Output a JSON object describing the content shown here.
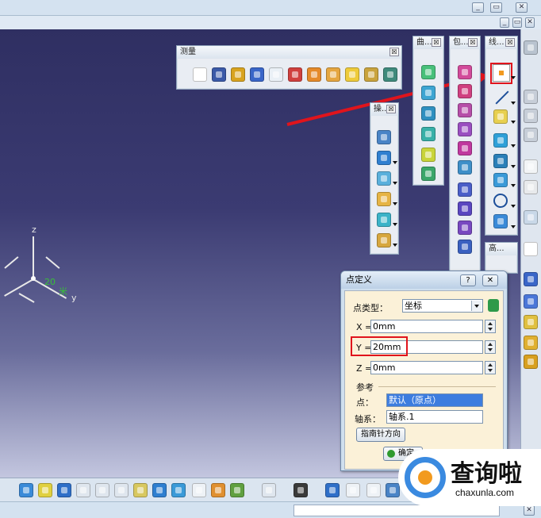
{
  "window": {
    "restore_glyph": "▭",
    "close_glyph": "✕",
    "minimize_glyph": "_"
  },
  "toolbars": {
    "measure": {
      "title": "测量",
      "close_glyph": "☒"
    },
    "curves": {
      "title": "曲...",
      "close_glyph": "☒"
    },
    "surfaces": {
      "title": "包...",
      "close_glyph": "☒"
    },
    "wireframe": {
      "title": "线...",
      "close_glyph": "☒"
    },
    "operations": {
      "title": "操...",
      "close_glyph": "☒"
    },
    "advanced": {
      "title": "高..."
    }
  },
  "compass": {
    "z": "z",
    "y": "y",
    "value": "20",
    "mark": "米"
  },
  "dialog": {
    "title": "点定义",
    "help_glyph": "?",
    "close_glyph": "✕",
    "point_type_label": "点类型：",
    "point_type_value": "坐标",
    "x_label": "X =",
    "x_value": "0mm",
    "y_label": "Y =",
    "y_value": "20mm",
    "z_label": "Z =",
    "z_value": "0mm",
    "reference_label": "参考",
    "point_label": "点：",
    "point_value": "默认（原点）",
    "axis_label": "轴系：",
    "axis_value": "轴系.1",
    "compass_button": "指南针方向",
    "ok_button": "确定"
  },
  "watermark": {
    "brand": "查询啦",
    "domain": "chaxunla.com"
  },
  "colors": {
    "annotation_red": "#e0141c",
    "viewport_top": "#2f2f62",
    "dialog_body": "#fbf1d8"
  }
}
